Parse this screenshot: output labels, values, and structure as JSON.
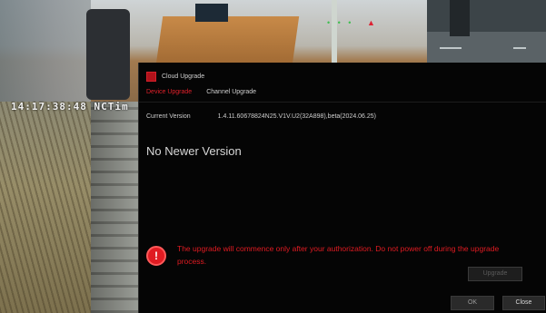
{
  "camera_osd": {
    "timestamp": "14:17:38:48 NCTim"
  },
  "dialog": {
    "title": "Cloud Upgrade",
    "tabs": [
      {
        "label": "Device Upgrade",
        "active": true
      },
      {
        "label": "Channel Upgrade",
        "active": false
      }
    ],
    "current_version_label": "Current Version",
    "current_version_value": "1.4.11.60678824N25.V1V.U2(32A898),beta(2024.06.25)",
    "status_message": "No Newer Version",
    "warning_message": "The upgrade will commence only after your authorization. Do not power off during the upgrade process.",
    "buttons": {
      "upgrade": "Upgrade",
      "ok": "OK",
      "close": "Close"
    }
  },
  "colors": {
    "accent": "#e01b22",
    "dialog_bg": "#050505"
  }
}
